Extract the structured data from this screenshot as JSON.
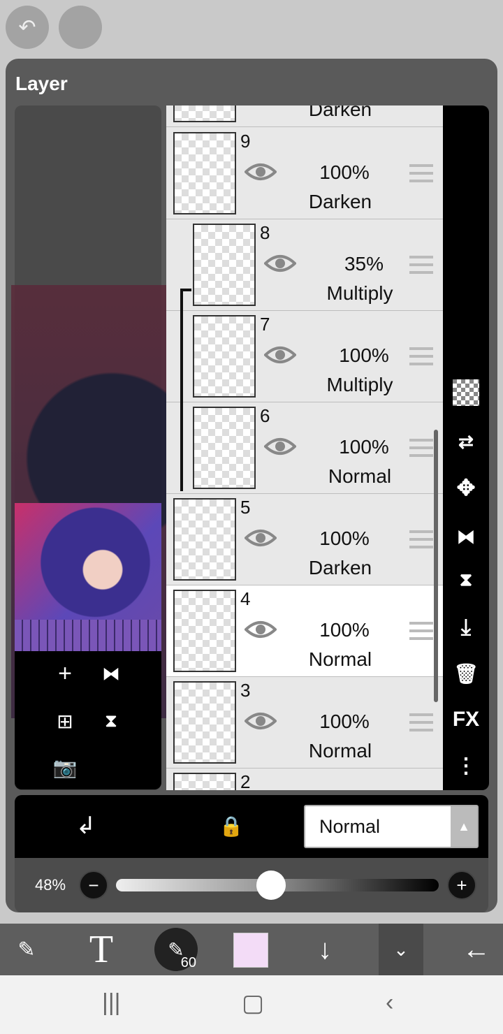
{
  "panel_title": "Layer",
  "layers": [
    {
      "num": "",
      "opacity": "",
      "mode": "Darken",
      "clipped": false,
      "selected": false,
      "partial": "top"
    },
    {
      "num": "9",
      "opacity": "100%",
      "mode": "Darken",
      "clipped": false,
      "selected": false
    },
    {
      "num": "8",
      "opacity": "35%",
      "mode": "Multiply",
      "clipped": true,
      "selected": false
    },
    {
      "num": "7",
      "opacity": "100%",
      "mode": "Multiply",
      "clipped": true,
      "selected": false
    },
    {
      "num": "6",
      "opacity": "100%",
      "mode": "Normal",
      "clipped": true,
      "selected": false
    },
    {
      "num": "5",
      "opacity": "100%",
      "mode": "Darken",
      "clipped": false,
      "selected": false
    },
    {
      "num": "4",
      "opacity": "100%",
      "mode": "Normal",
      "clipped": false,
      "selected": true
    },
    {
      "num": "3",
      "opacity": "100%",
      "mode": "Normal",
      "clipped": false,
      "selected": false
    },
    {
      "num": "2",
      "opacity": "",
      "mode": "",
      "clipped": false,
      "selected": false,
      "partial": "bottom"
    }
  ],
  "side_fx": "FX",
  "blend_mode": "Normal",
  "opacity_label": "48%",
  "opacity_value": 48,
  "brush_size": "60",
  "current_color": "#f3dcf7"
}
